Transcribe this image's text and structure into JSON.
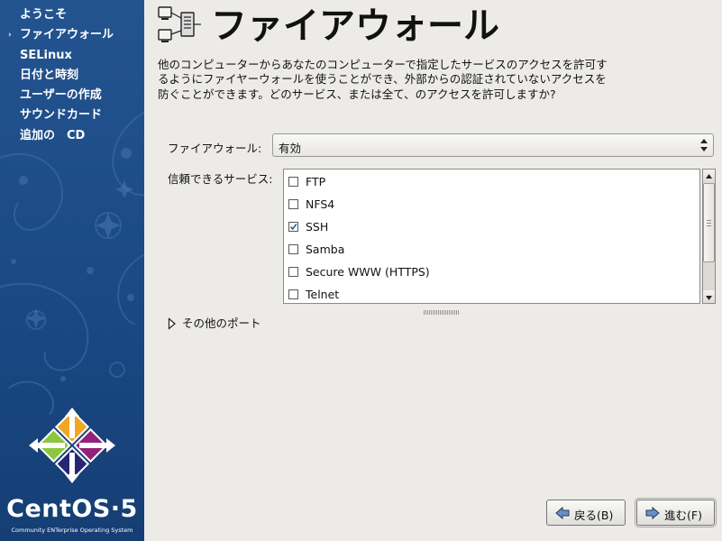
{
  "sidebar": {
    "items": [
      {
        "label": "ようこそ"
      },
      {
        "label": "ファイアウォール",
        "current_marker": "›"
      },
      {
        "label": "SELinux"
      },
      {
        "label": "日付と時刻"
      },
      {
        "label": "ユーザーの作成"
      },
      {
        "label": "サウンドカード"
      },
      {
        "label": "追加の　CD"
      }
    ],
    "brand": "CentOS·5",
    "brand_tagline": "Community ENTerprise Operating System"
  },
  "header": {
    "title": "ファイアウォール",
    "icon": "firewall-network-icon"
  },
  "description": "他のコンピューターからあなたのコンピューターで指定したサービスのアクセスを許可するようにファイヤーウォールを使うことができ、外部からの認証されていないアクセスを防ぐことができます。どのサービス、または全て、のアクセスを許可しますか?",
  "firewall": {
    "label": "ファイアウォール:",
    "value": "有効"
  },
  "services": {
    "label": "信頼できるサービス:",
    "items": [
      {
        "name": "FTP",
        "checked": false
      },
      {
        "name": "NFS4",
        "checked": false
      },
      {
        "name": "SSH",
        "checked": true
      },
      {
        "name": "Samba",
        "checked": false
      },
      {
        "name": "Secure WWW (HTTPS)",
        "checked": false
      },
      {
        "name": "Telnet",
        "checked": false
      }
    ]
  },
  "other_ports": {
    "label": "その他のポート"
  },
  "buttons": {
    "back_label": "戻る(B)",
    "next_label": "進む(F)"
  },
  "colors": {
    "sidebar": "#1b4a86",
    "window_bg": "#ecebe8",
    "logo_purple": "#932279",
    "logo_green": "#8cc63f",
    "logo_orange": "#efa724",
    "logo_navy": "#262577"
  }
}
